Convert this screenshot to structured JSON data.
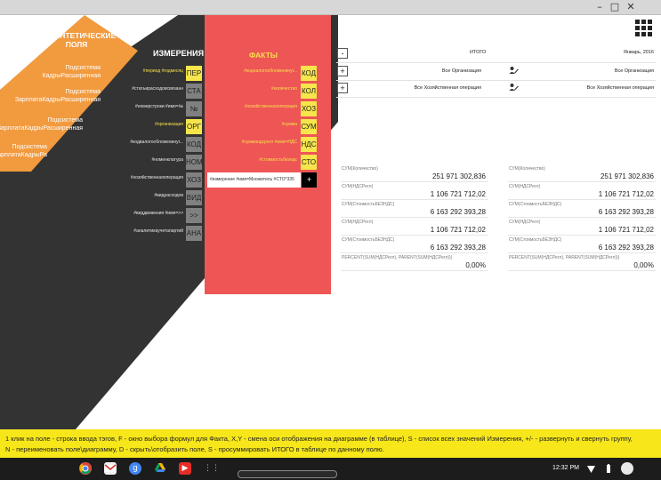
{
  "window": {
    "minimize_icon": "minimize-icon",
    "maximize_icon": "maximize-icon",
    "close_icon": "close-icon"
  },
  "synthetic": {
    "title": "СИНТЕТИЧЕСКИЕ ПОЛЯ",
    "items": [
      "Подсистема КадрыРасширенная",
      "Подсистема ЗарплатаКадрыРасширенная",
      "Подсистема ЗарплатаКадрыРасширенная",
      "Подсистема ЗарплатаКадрыРасширенная"
    ]
  },
  "dimensions": {
    "header": "ИЗМЕРЕНИЯ",
    "rows": [
      {
        "label": "#период #годмесяц",
        "tag": "ПЕР",
        "active": true
      },
      {
        "label": "#статьирасходовсвязанн",
        "tag": "СТА",
        "active": false
      },
      {
        "label": "#номерстроки #имя=№",
        "tag": "№",
        "active": false
      },
      {
        "label": "#организация",
        "tag": "ОРГ",
        "active": true
      },
      {
        "label": "#кодвалогообложенинуг...",
        "tag": "КОД",
        "active": false
      },
      {
        "label": "#номенклатура",
        "tag": "НОМ",
        "active": false
      },
      {
        "label": "#хозяйственнаяоперация",
        "tag": "ХОЗ",
        "active": false
      },
      {
        "label": "#видрасходов",
        "tag": "ВИД",
        "active": false
      },
      {
        "label": "#виддвижения #имя=>>",
        "tag": ">>",
        "active": false
      },
      {
        "label": "#аналитикаучетапартий",
        "tag": "АНА",
        "active": false
      }
    ]
  },
  "facts": {
    "header": "ФАКТЫ",
    "rows": [
      {
        "label": "#кодналогообложенинуг...",
        "tag": "КОД"
      },
      {
        "label": "#количество",
        "tag": "КОЛ"
      },
      {
        "label": "#хозяйственнаяоперация",
        "tag": "ХОЗ"
      },
      {
        "label": "#сумма",
        "tag": "СУМ"
      },
      {
        "label": "#суммандсрегл #имя=НДС",
        "tag": "НДС"
      },
      {
        "label": "#стоимостьбезндс",
        "tag": "СТО"
      }
    ],
    "formula": "#измерение #имя=Множитель #СТО*335",
    "add_label": "+"
  },
  "table": {
    "grid_icon": "grid-icon",
    "rows": [
      {
        "toggle": "-",
        "left": "ИТОГО",
        "right": "Январь, 2016",
        "editable": false
      },
      {
        "toggle": "+",
        "left": "Все Организация",
        "right": "Все Организация",
        "editable": true
      },
      {
        "toggle": "+",
        "left": "Все Хозяйственная операция",
        "right": "Все Хозяйственная операция",
        "editable": true
      }
    ],
    "cells": [
      {
        "label": "СУМ(Количество)",
        "value": "251 971 302,836"
      },
      {
        "label": "СУМ(НДСРегл)",
        "value": "1 106 721 712,02"
      },
      {
        "label": "СУМ(СтоимостьБЕЗНДС)",
        "value": "6 163 292 393,28"
      },
      {
        "label": "СУМ(НДСРегл)",
        "value": "1 106 721 712,02"
      },
      {
        "label": "СУМ(СтоимостьБЕЗНДС)",
        "value": "6 163 292 393,28"
      },
      {
        "label": "PERCENT(SUM(НДСРегл), PARENT(SUM(НДСРегл)))",
        "value": "0,00%"
      }
    ]
  },
  "help": {
    "line1": "1 клик на поле - строка ввода тэгов, F - окно выбора формул для Факта, X,Y - смена оси отображения на диаграмме (в таблице), S - список всех значений Измерения, +/-  - развернуть и свернуть группу,",
    "line2": "N - переименовать поле\\диаграмму,  D - скрыть\\отобразить поле, S - просуммировать ИТОГО в таблице по данному полю."
  },
  "taskbar": {
    "apps": [
      "chrome-icon",
      "gmail-icon",
      "google-search-icon",
      "drive-icon",
      "youtube-icon",
      "app-launcher-icon"
    ],
    "time": "12:32 PM",
    "status_icons": [
      "wifi-icon",
      "battery-icon",
      "avatar"
    ]
  },
  "colors": {
    "dark": "#333333",
    "orange": "#f29a3e",
    "red": "#ee5555",
    "yellow": "#f6e64b",
    "help_bar": "#f6e61a"
  }
}
